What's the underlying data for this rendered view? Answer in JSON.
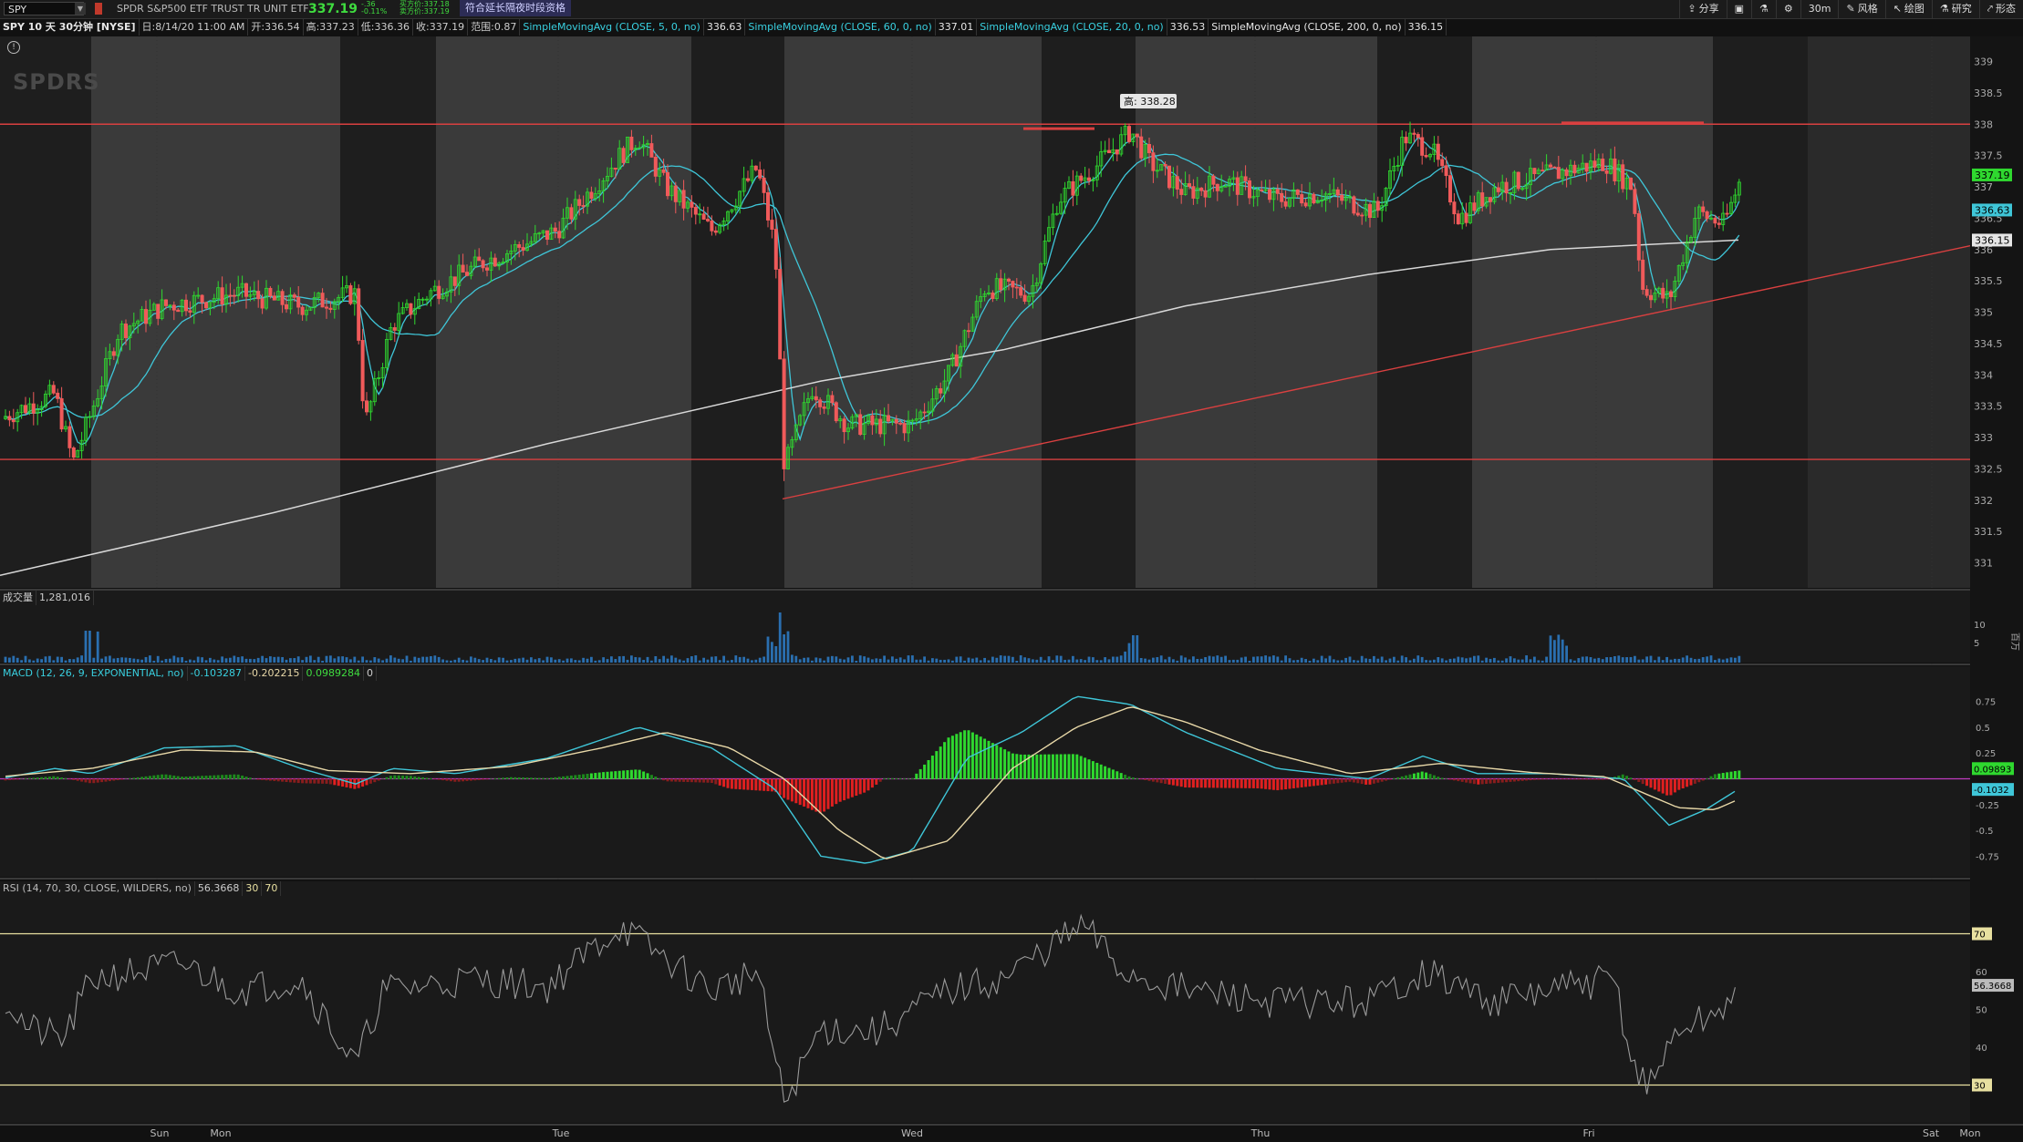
{
  "header": {
    "symbol": "SPY",
    "description": "SPDR S&P500 ETF TRUST TR UNIT ETF",
    "last": "337.19",
    "change": "-.36",
    "change_pct": "-0.11%",
    "bid": "买方价:337.18",
    "ask": "卖方价:337.19",
    "extended_hours": "符合延长隔夜时段资格"
  },
  "toolbar": {
    "share": "分享",
    "timeframe": "30m",
    "style": "风格",
    "drawing": "绘图",
    "study": "研究",
    "pattern": "形态"
  },
  "info": {
    "title": "SPY 10 天 30分钟 [NYSE]",
    "date": "日:8/14/20 11:00 AM",
    "open": "开:336.54",
    "high": "高:337.23",
    "low": "低:336.36",
    "close": "收:337.19",
    "range": "范围:0.87",
    "sma5_label": "SimpleMovingAvg (CLOSE, 5, 0, no)",
    "sma5_value": "336.63",
    "sma60_label": "SimpleMovingAvg (CLOSE, 60, 0, no)",
    "sma60_value": "337.01",
    "sma20_label": "SimpleMovingAvg (CLOSE, 20, 0, no)",
    "sma20_value": "336.53",
    "sma200_label": "SimpleMovingAvg (CLOSE, 200, 0, no)",
    "sma200_value": "336.15"
  },
  "watermark": "SPDRS",
  "price_pane": {
    "high_marker": "高: 338.28",
    "axis_ticks": [
      "339",
      "338.5",
      "338",
      "337.5",
      "337",
      "336.5",
      "336",
      "335.5",
      "335",
      "334.5",
      "334",
      "333.5",
      "333",
      "332.5",
      "332",
      "331.5",
      "331"
    ],
    "price_badges": [
      "337.19",
      "336.63",
      "336.15"
    ],
    "resistance": 338,
    "support": 332.65
  },
  "volume_pane": {
    "label": "成交量",
    "value": "1,281,016",
    "axis_ticks": [
      "10",
      "5"
    ],
    "axis_label": "百万"
  },
  "macd_pane": {
    "label": "MACD (12, 26, 9, EXPONENTIAL, no)",
    "values": [
      "-0.103287",
      "-0.202215",
      "0.0989284",
      "0"
    ],
    "axis_ticks": [
      "0.75",
      "0.5",
      "0.25",
      "-0.25",
      "-0.5",
      "-0.75"
    ],
    "badges": [
      "0.09893",
      "-0.1032"
    ]
  },
  "rsi_pane": {
    "label": "RSI (14, 70, 30, CLOSE, WILDERS, no)",
    "value": "56.3668",
    "levels": [
      "30",
      "70"
    ],
    "axis_ticks": [
      "60",
      "50",
      "40"
    ],
    "badges": [
      "70",
      "56.3668",
      "30"
    ]
  },
  "time_axis": [
    "Sun",
    "Mon",
    "Tue",
    "Wed",
    "Thu",
    "Fri",
    "Sat",
    "Mon"
  ],
  "colors": {
    "up": "#2fd82f",
    "down": "#f05a5a",
    "sma_cyan": "#3fc6d8",
    "sma200": "#d8d8d8",
    "resistance": "#d94040",
    "macd_line": "#3fc6d8",
    "signal_line": "#e8d8a8",
    "rsi_level": "#e8e0a0"
  }
}
